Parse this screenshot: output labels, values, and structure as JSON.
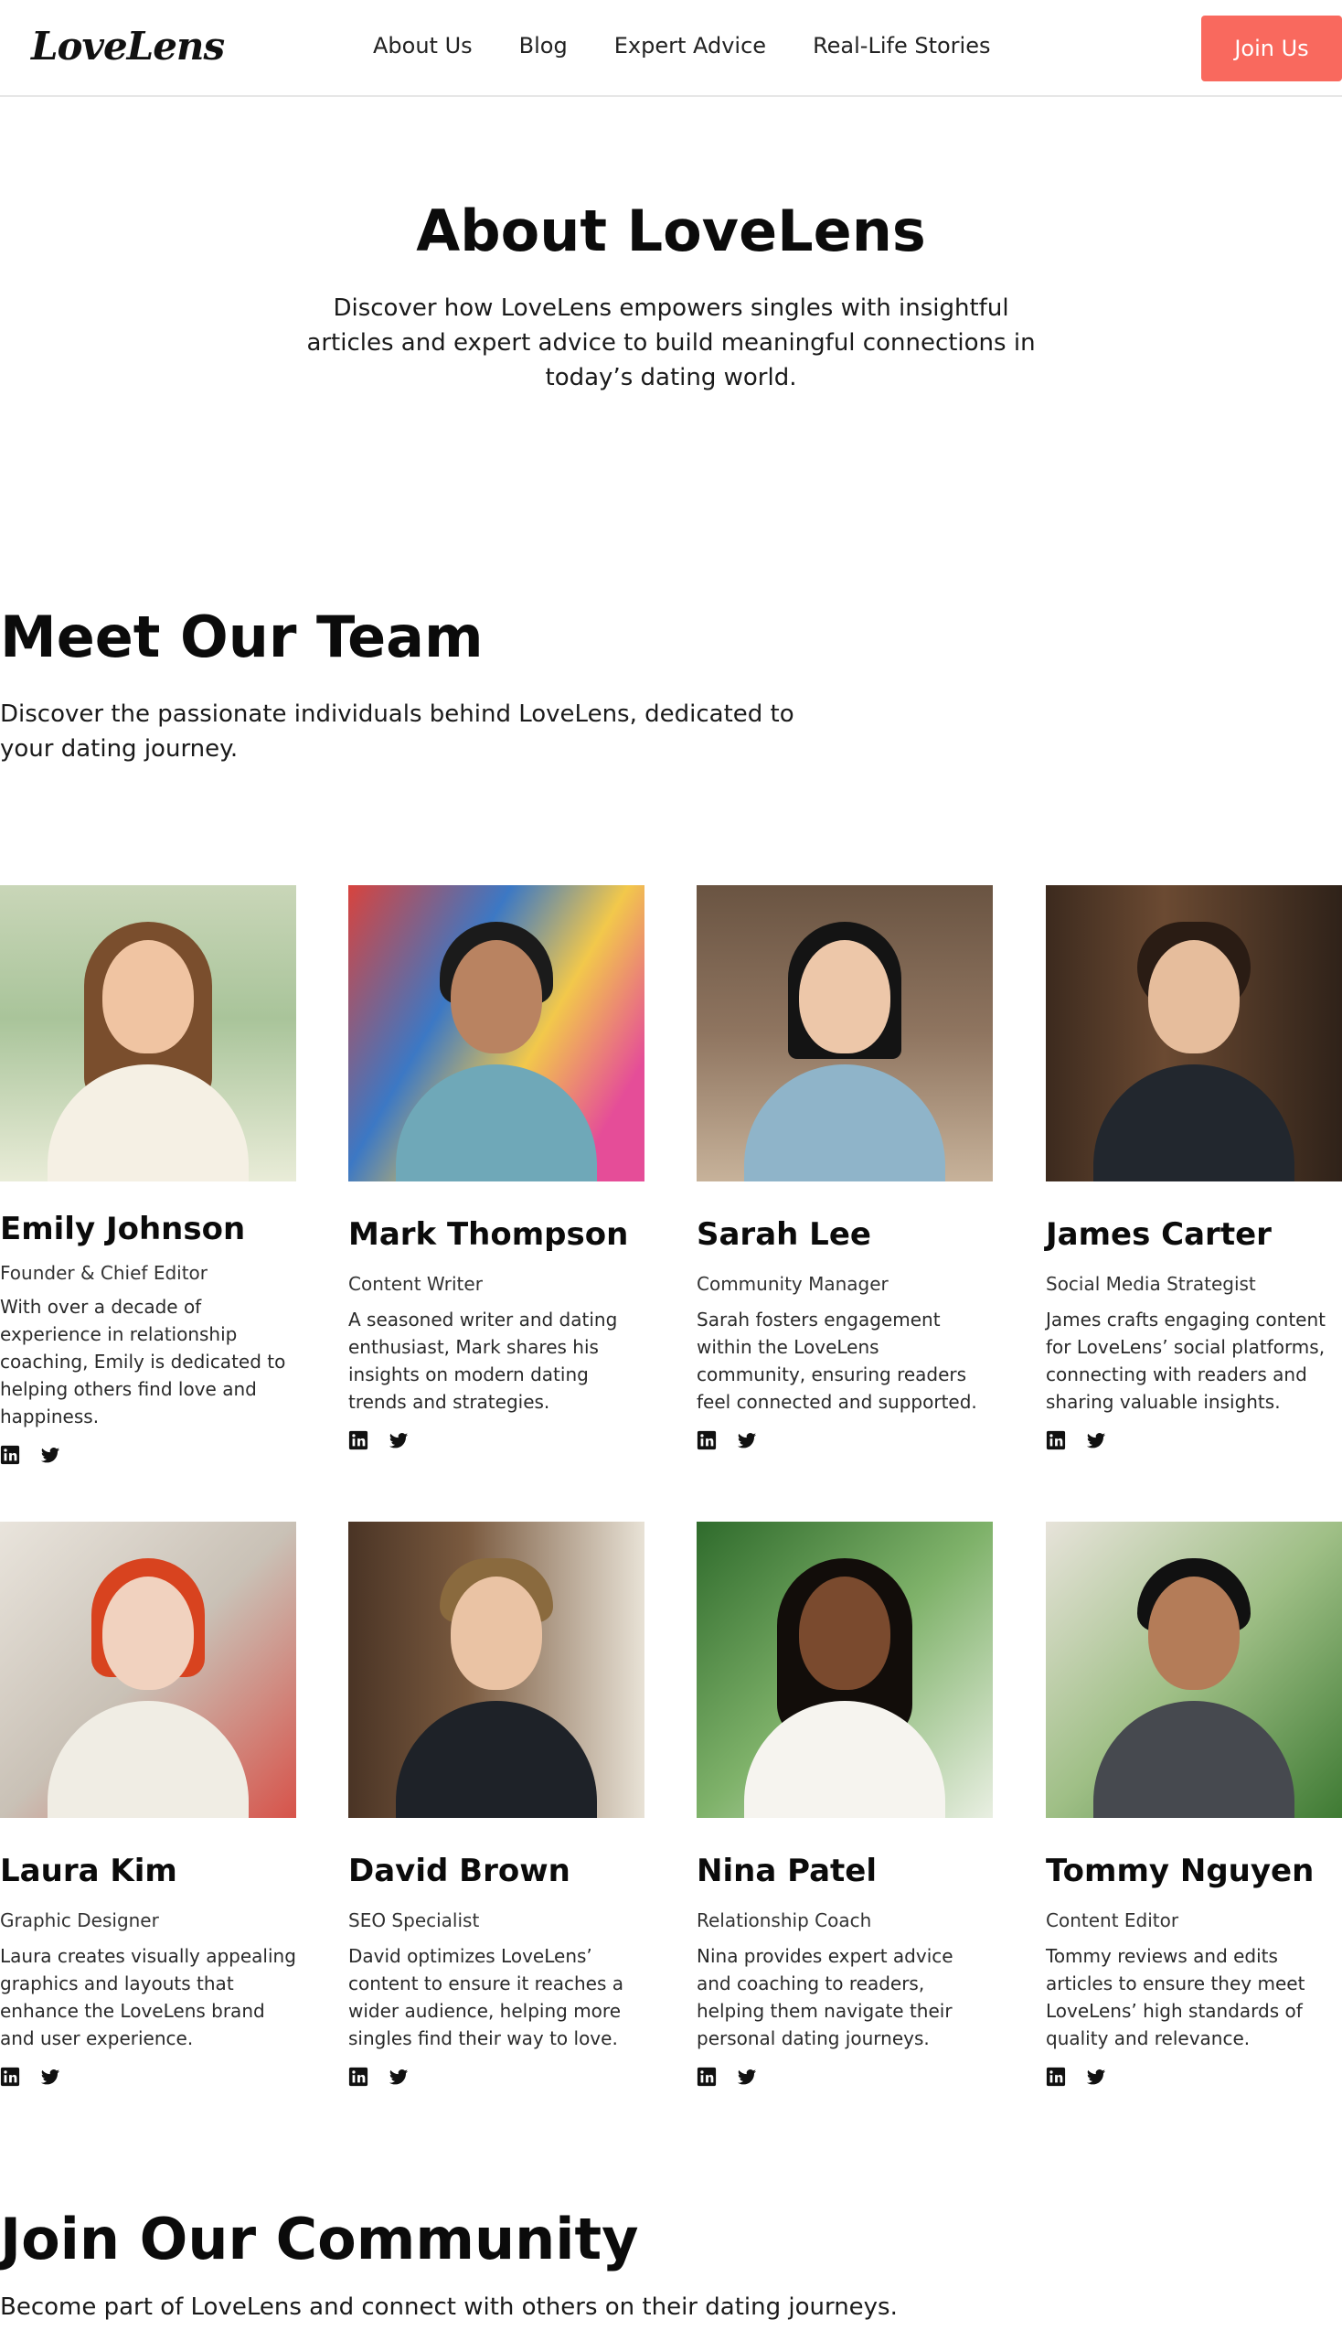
{
  "header": {
    "logo": "LoveLens",
    "nav": [
      "About Us",
      "Blog",
      "Expert Advice",
      "Real-Life Stories"
    ],
    "join_label": "Join Us"
  },
  "about": {
    "title": "About LoveLens",
    "description": "Discover how LoveLens empowers singles with insightful articles and expert advice to build meaningful connections in today’s dating world."
  },
  "team": {
    "title": "Meet Our Team",
    "description": "Discover the passionate individuals behind LoveLens, dedicated to your dating journey.",
    "members": [
      {
        "name": "Emily Johnson",
        "role": "Founder & Chief Editor",
        "bio": "With over a decade of experience in relationship coaching, Emily is dedicated to helping others find love and happiness."
      },
      {
        "name": "Mark Thompson",
        "role": "Content Writer",
        "bio": "A seasoned writer and dating enthusiast, Mark shares his insights on modern dating trends and strategies."
      },
      {
        "name": "Sarah Lee",
        "role": "Community Manager",
        "bio": "Sarah fosters engagement within the LoveLens community, ensuring readers feel connected and supported."
      },
      {
        "name": "James Carter",
        "role": "Social Media Strategist",
        "bio": "James crafts engaging content for LoveLens’ social platforms, connecting with readers and sharing valuable insights."
      },
      {
        "name": "Laura Kim",
        "role": "Graphic Designer",
        "bio": "Laura creates visually appealing graphics and layouts that enhance the LoveLens brand and user experience."
      },
      {
        "name": "David Brown",
        "role": "SEO Specialist",
        "bio": "David optimizes LoveLens’ content to ensure it reaches a wider audience, helping more singles find their way to love."
      },
      {
        "name": "Nina Patel",
        "role": "Relationship Coach",
        "bio": "Nina provides expert advice and coaching to readers, helping them navigate their personal dating journeys."
      },
      {
        "name": "Tommy Nguyen",
        "role": "Content Editor",
        "bio": "Tommy reviews and edits articles to ensure they meet LoveLens’ high standards of quality and relevance."
      }
    ],
    "social_icons": [
      "linkedin-icon",
      "twitter-icon"
    ]
  },
  "community": {
    "title": "Join Our Community",
    "description": "Become part of LoveLens and connect with others on their dating journeys."
  },
  "colors": {
    "accent": "#f9695e"
  }
}
